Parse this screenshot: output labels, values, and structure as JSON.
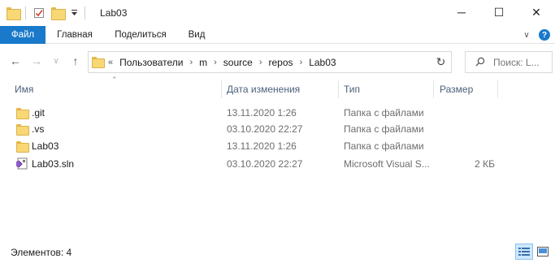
{
  "window": {
    "title": "Lab03",
    "minimize_glyph": "─",
    "maximize_glyph": "☐",
    "close_glyph": "✕"
  },
  "ribbon": {
    "tabs": [
      "Файл",
      "Главная",
      "Поделиться",
      "Вид"
    ],
    "active_tab": "Файл",
    "expand_glyph": "∨",
    "help_glyph": "?"
  },
  "nav": {
    "back_glyph": "←",
    "forward_glyph": "→",
    "recent_glyph": "∨",
    "up_glyph": "↑",
    "overflow": "«",
    "breadcrumbs": [
      "Пользователи",
      "m",
      "source",
      "repos",
      "Lab03"
    ],
    "separator": "›",
    "refresh_glyph": "↻",
    "search_placeholder": "Поиск: L..."
  },
  "columns": [
    "Имя",
    "Дата изменения",
    "Тип",
    "Размер"
  ],
  "sort_glyph": "⌃",
  "files": [
    {
      "name": ".git",
      "date": "13.11.2020 1:26",
      "type": "Папка с файлами",
      "size": "",
      "icon": "folder-icon"
    },
    {
      "name": ".vs",
      "date": "03.10.2020 22:27",
      "type": "Папка с файлами",
      "size": "",
      "icon": "folder-icon"
    },
    {
      "name": "Lab03",
      "date": "13.11.2020 1:26",
      "type": "Папка с файлами",
      "size": "",
      "icon": "folder-icon"
    },
    {
      "name": "Lab03.sln",
      "date": "03.10.2020 22:27",
      "type": "Microsoft Visual S...",
      "size": "2 КБ",
      "icon": "visual-studio-solution-icon"
    }
  ],
  "status": {
    "item_count": "Элементов: 4"
  },
  "colors": {
    "accent": "#1979ca",
    "folder": "#f8d775",
    "header_text": "#4c607a"
  }
}
